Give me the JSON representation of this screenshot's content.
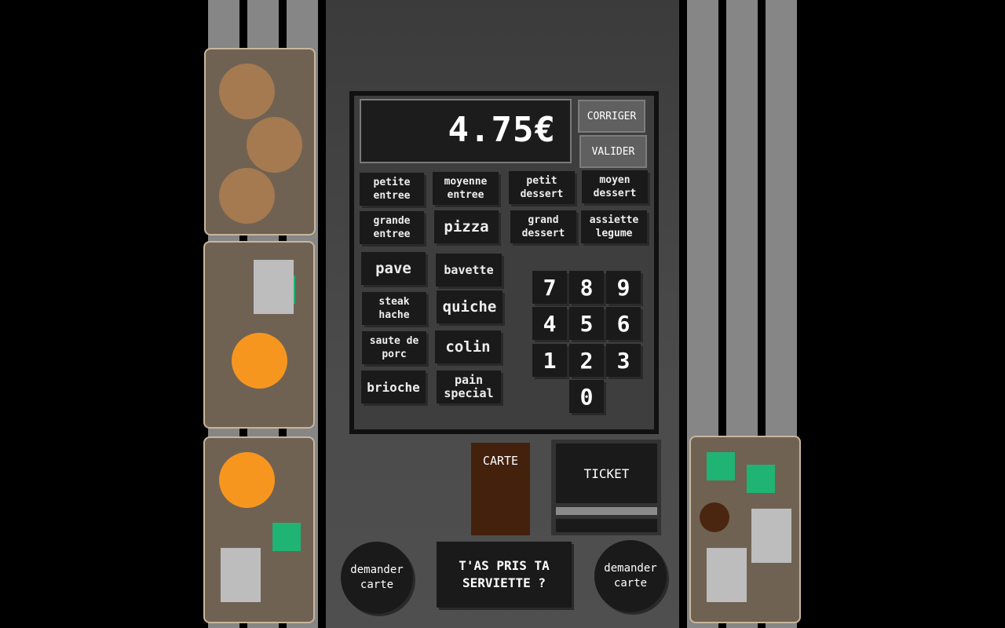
{
  "display": {
    "amount": "4.75€"
  },
  "controls": {
    "corriger": "CORRIGER",
    "valider": "VALIDER"
  },
  "menu_items": {
    "petite_entree": [
      "petite",
      "entree"
    ],
    "moyenne_entree": [
      "moyenne",
      "entree"
    ],
    "petit_dessert": [
      "petit",
      "dessert"
    ],
    "moyen_dessert": [
      "moyen",
      "dessert"
    ],
    "grande_entree": [
      "grande",
      "entree"
    ],
    "pizza": "pizza",
    "grand_dessert": [
      "grand",
      "dessert"
    ],
    "assiette_legume": [
      "assiette",
      "legume"
    ],
    "pave": "pave",
    "bavette": "bavette",
    "steak_hache": [
      "steak",
      "hache"
    ],
    "quiche": "quiche",
    "saute_de_porc": [
      "saute de",
      "porc"
    ],
    "colin": "colin",
    "brioche": "brioche",
    "pain_special": [
      "pain",
      "special"
    ]
  },
  "keypad": [
    "7",
    "8",
    "9",
    "4",
    "5",
    "6",
    "1",
    "2",
    "3",
    "0"
  ],
  "card_slot_label": "CARTE",
  "ticket_label": "TICKET",
  "demander_carte_left": [
    "demander",
    "carte"
  ],
  "demander_carte_right": [
    "demander",
    "carte"
  ],
  "serviette": [
    "T'AS PRIS TA",
    "SERVIETTE ?"
  ],
  "colors": {
    "bread": "#a57a50",
    "orange": "#f7961f",
    "green": "#1fb374",
    "plate": "#bdbdbd",
    "chocolate": "#4a2610",
    "tray": "#706253",
    "card_slot": "#43210d"
  }
}
